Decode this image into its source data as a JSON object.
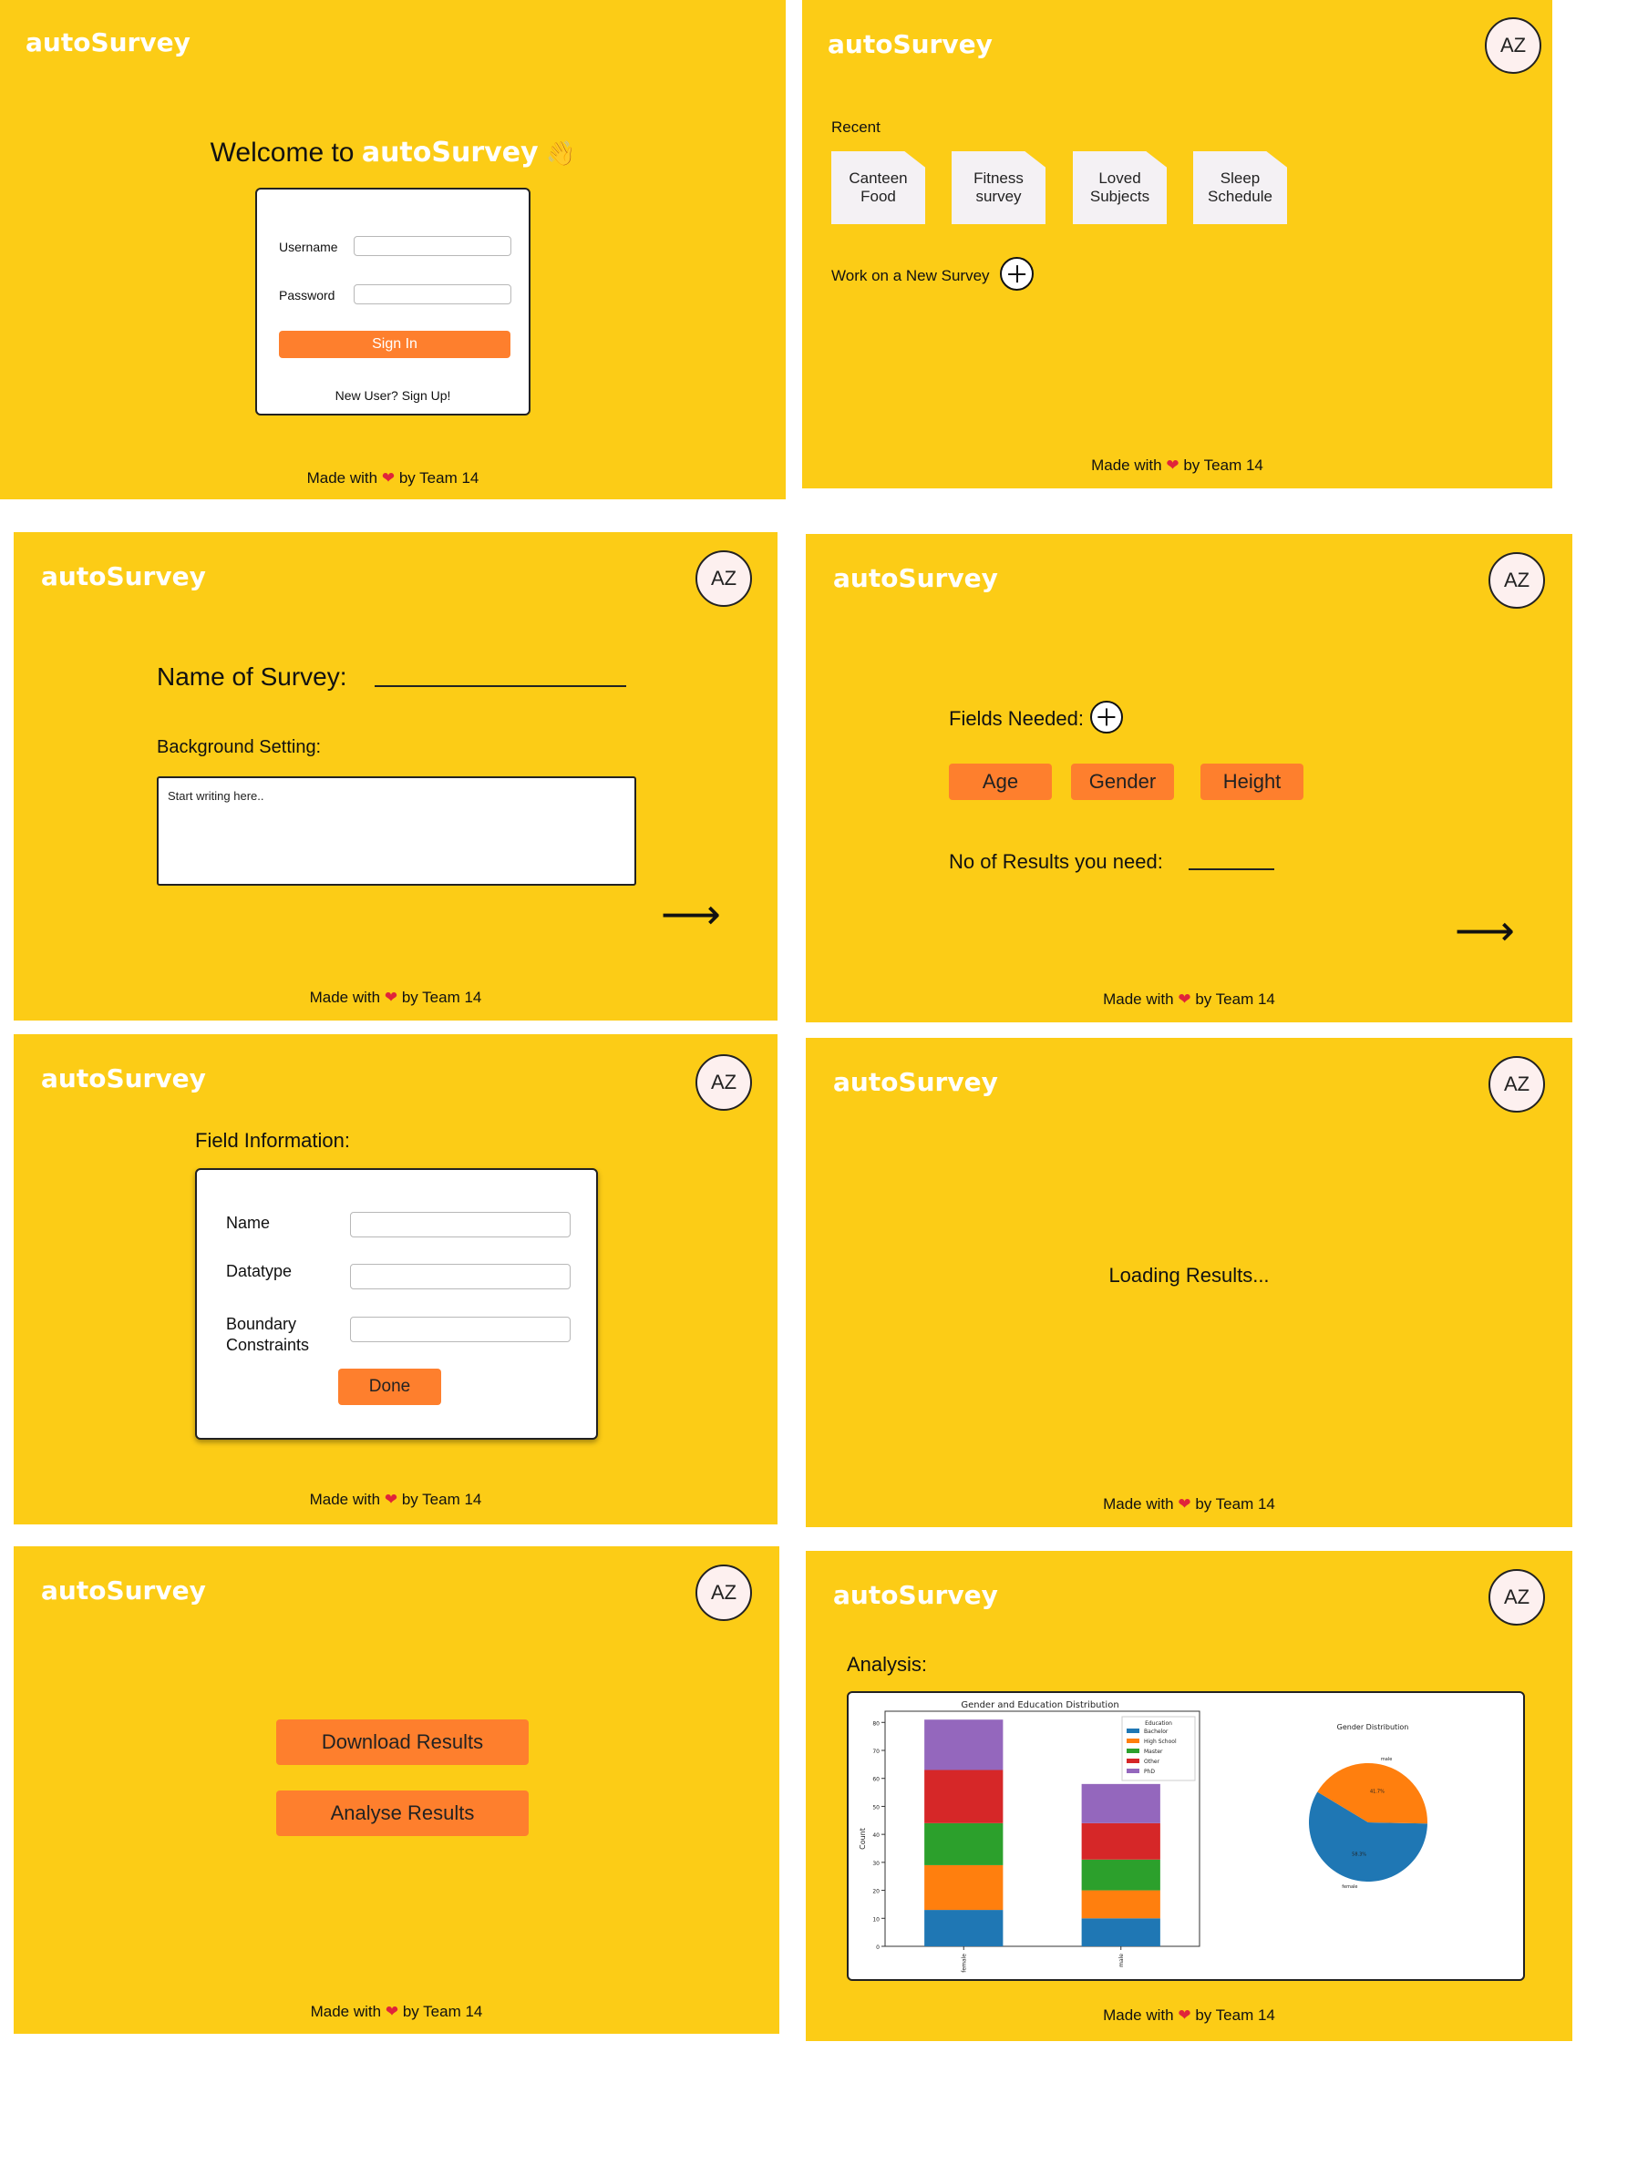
{
  "brand": "autoSurvey",
  "avatar": "AZ",
  "footer": {
    "prefix": "Made with",
    "suffix": "by Team 14"
  },
  "login": {
    "welcome_prefix": "Welcome to ",
    "welcome_brand": "autoSurvey",
    "wave": "👋",
    "username_label": "Username",
    "password_label": "Password",
    "sign_in": "Sign In",
    "signup_link": "New User? Sign Up!"
  },
  "dashboard": {
    "recent_label": "Recent",
    "recent": [
      {
        "l1": "Canteen",
        "l2": "Food"
      },
      {
        "l1": "Fitness",
        "l2": "survey"
      },
      {
        "l1": "Loved",
        "l2": "Subjects"
      },
      {
        "l1": "Sleep",
        "l2": "Schedule"
      }
    ],
    "new_survey": "Work on a New Survey"
  },
  "survey_setup": {
    "name_label": "Name of Survey:",
    "background_label": "Background Setting:",
    "background_placeholder": "Start writing here.."
  },
  "fields": {
    "fields_needed": "Fields Needed:",
    "chips": [
      "Age",
      "Gender",
      "Height"
    ],
    "results_label": "No of Results you need:"
  },
  "field_info": {
    "title": "Field Information:",
    "name_label": "Name",
    "datatype_label": "Datatype",
    "boundary_l1": "Boundary",
    "boundary_l2": "Constraints",
    "done": "Done"
  },
  "loading": {
    "text": "Loading Results..."
  },
  "results": {
    "download": "Download Results",
    "analyse": "Analyse Results"
  },
  "analysis": {
    "title": "Analysis:"
  },
  "chart_data": [
    {
      "type": "bar",
      "stacked": true,
      "title": "Gender and Education Distribution",
      "ylabel": "Count",
      "categories": [
        "female",
        "male"
      ],
      "ylim": [
        0,
        84
      ],
      "yticks": [
        0,
        10,
        20,
        30,
        40,
        50,
        60,
        70,
        80
      ],
      "legend_title": "Education",
      "legend_position": "top-right",
      "series": [
        {
          "name": "Bachelor",
          "color": "#1f77b4",
          "values": [
            13,
            10
          ]
        },
        {
          "name": "High School",
          "color": "#ff7f0e",
          "values": [
            16,
            10
          ]
        },
        {
          "name": "Master",
          "color": "#2ca02c",
          "values": [
            15,
            11
          ]
        },
        {
          "name": "Other",
          "color": "#d62728",
          "values": [
            19,
            13
          ]
        },
        {
          "name": "PhD",
          "color": "#9467bd",
          "values": [
            18,
            14
          ]
        }
      ]
    },
    {
      "type": "pie",
      "title": "Gender Distribution",
      "labels": [
        "female",
        "male"
      ],
      "values": [
        58.3,
        41.7
      ],
      "value_labels": [
        "58.3%",
        "41.7%"
      ],
      "colors": [
        "#1f77b4",
        "#ff7f0e"
      ]
    }
  ]
}
